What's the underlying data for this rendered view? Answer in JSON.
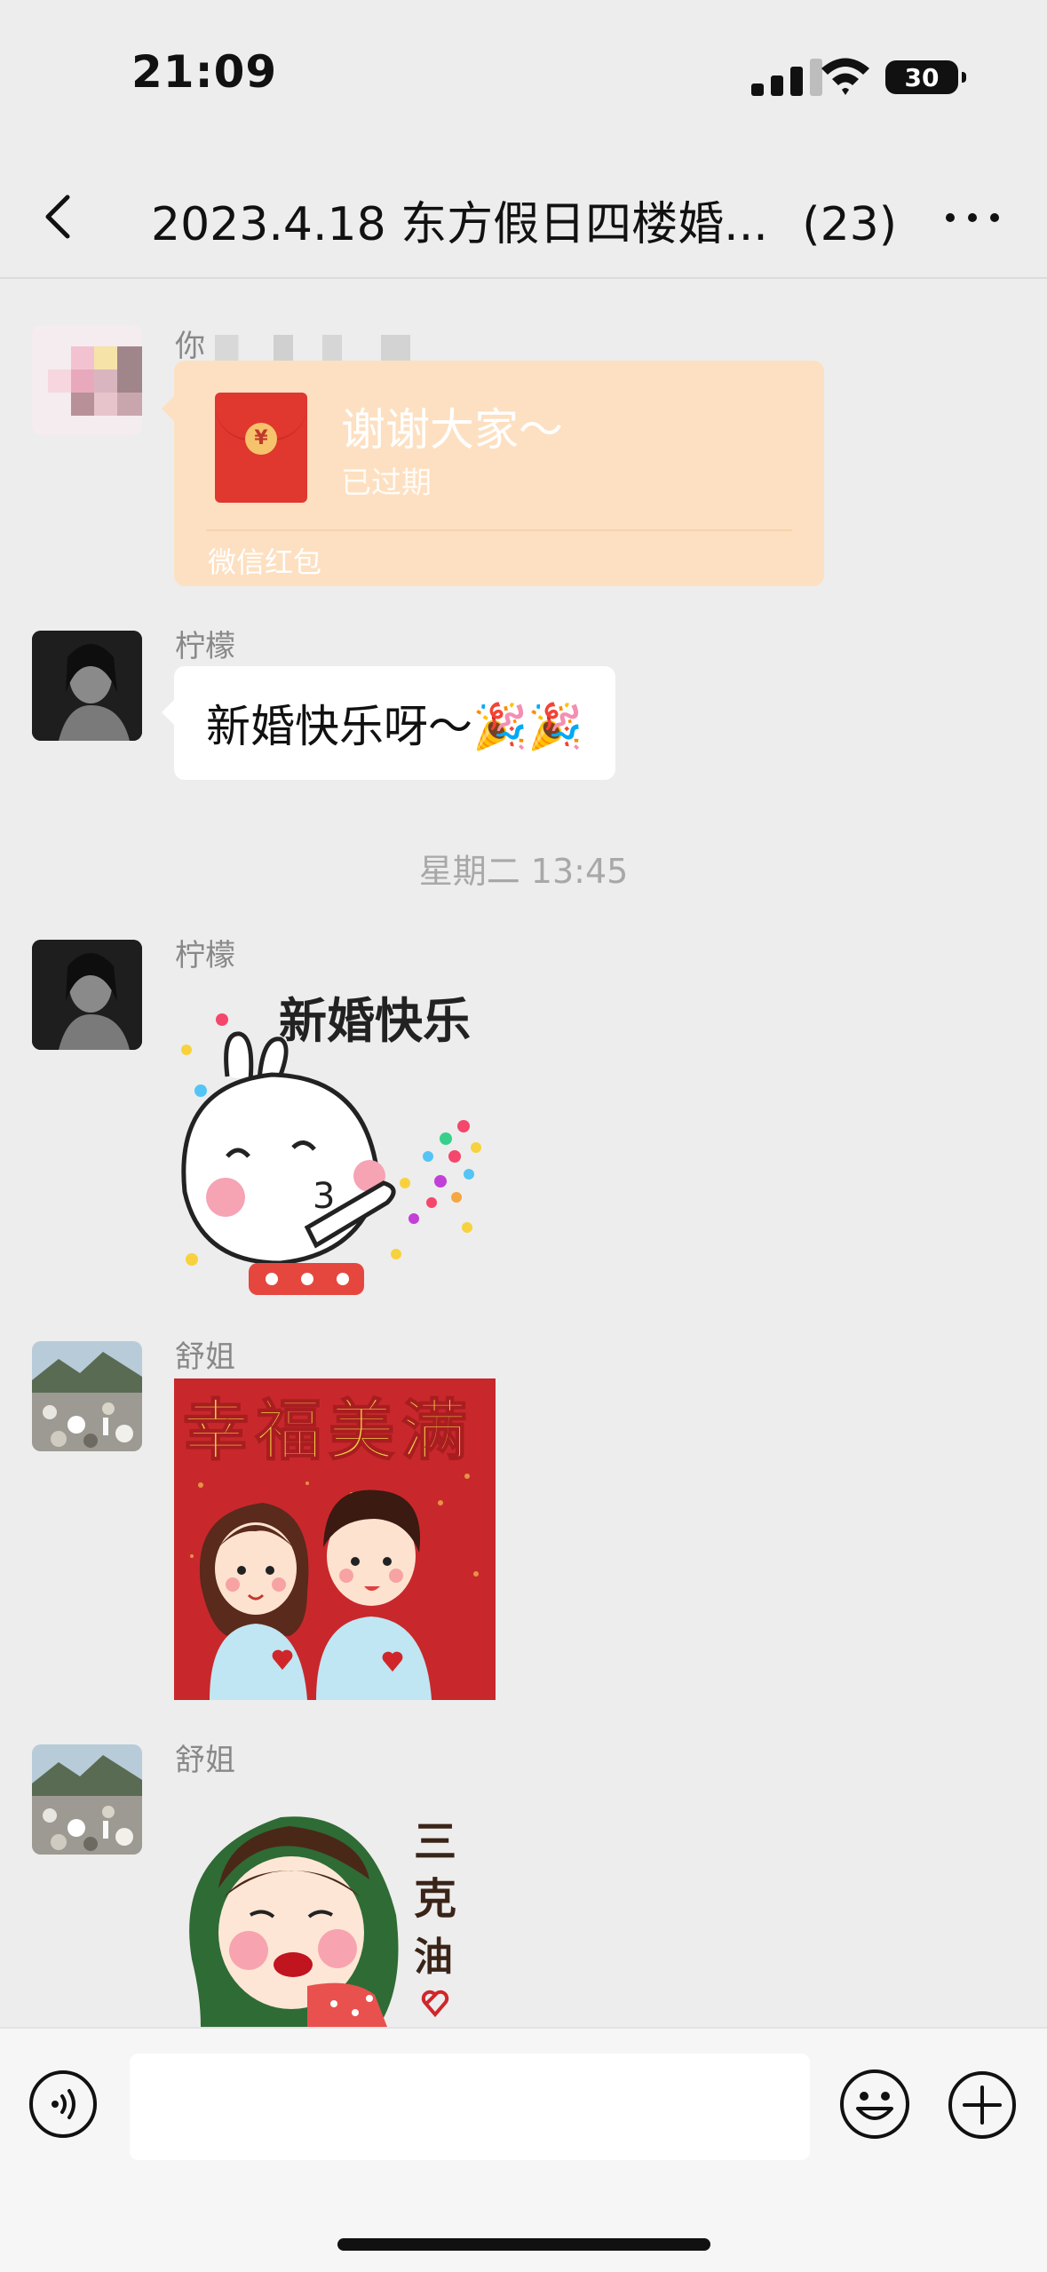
{
  "status": {
    "time": "21:09",
    "battery": "30"
  },
  "header": {
    "title": "2023.4.18 东方假日四楼婚...",
    "count": "(23)"
  },
  "messages": {
    "m1": {
      "sender": "你",
      "packet_title": "谢谢大家～",
      "packet_status": "已过期",
      "packet_label": "微信红包"
    },
    "m2": {
      "sender": "柠檬",
      "text": "新婚快乐呀～🎉🎉"
    },
    "ts": "星期二 13:45",
    "m3": {
      "sender": "柠檬",
      "sticker_text": "新婚快乐"
    },
    "m4": {
      "sender": "舒姐",
      "sticker_text": "幸福美满"
    },
    "m5": {
      "sender": "舒姐",
      "sticker_text": [
        "三",
        "克",
        "油"
      ]
    }
  },
  "input": {
    "value": ""
  },
  "icons": [
    "back-icon",
    "more-icon",
    "signal-icon",
    "wifi-icon",
    "battery-icon",
    "voice-icon",
    "emoji-icon",
    "plus-icon",
    "red-packet-icon"
  ],
  "colors": {
    "background": "#ededed",
    "red_packet": "#fde0c1",
    "red_packet_icon": "#e0372f",
    "bubble": "#ffffff",
    "meta_text": "#888888"
  }
}
